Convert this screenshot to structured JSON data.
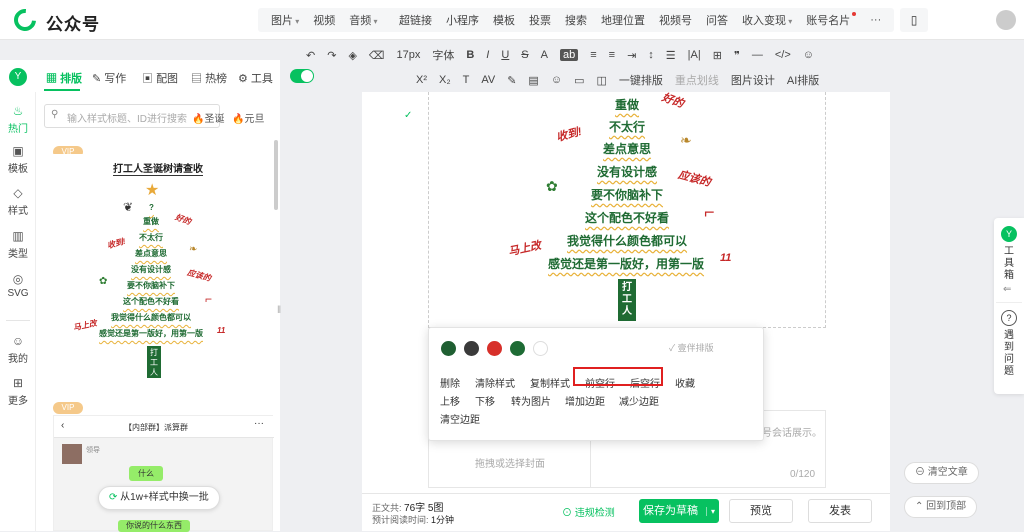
{
  "app": {
    "name": "公众号"
  },
  "topnav": {
    "group1": [
      "图片",
      "视频",
      "音频"
    ],
    "group2": [
      "超链接",
      "小程序",
      "模板",
      "投票",
      "搜索",
      "地理位置",
      "视频号",
      "问答",
      "收入变现",
      "账号名片"
    ],
    "more": "···"
  },
  "toolbar2": {
    "font_size": "17px",
    "font_label": "字体",
    "bold": "B",
    "italic": "I",
    "underline": "U",
    "strike": "S",
    "quote": "❞"
  },
  "toolbar3": {
    "auto_layout": "一键排版",
    "highlight": "重点划线",
    "image_design": "图片设计",
    "ai_layout": "AI排版"
  },
  "panel": {
    "tabs": [
      "排版",
      "写作",
      "配图",
      "热榜",
      "工具"
    ],
    "search_placeholder": "输入样式标题、ID进行搜索",
    "tags": [
      "圣诞",
      "元旦"
    ],
    "vip": "VIP",
    "card1": {
      "title": "打工人圣诞树请查收",
      "q": "?",
      "lines": [
        "重做",
        "不太行",
        "差点意思",
        "没有设计感",
        "要不你脑补下",
        "这个配色不好看",
        "我觉得什么颜色都可以",
        "感觉还是第一版好，用第一版"
      ],
      "side": [
        "好的",
        "收到!",
        "应该的",
        "马上改",
        "11"
      ],
      "box": "打工人"
    },
    "card2": {
      "title": "【内部群】派算群",
      "user": "领导",
      "msgs": [
        "什么",
        "你说的什么东西"
      ],
      "swap": "从1w+样式中换一批"
    }
  },
  "leftrail": [
    "热门",
    "模板",
    "样式",
    "类型",
    "SVG",
    "我的",
    "更多"
  ],
  "editor": {
    "lines": [
      "重做",
      "不太行",
      "差点意思",
      "没有设计感",
      "要不你脑补下",
      "这个配色不好看",
      "我觉得什么颜色都可以",
      "感觉还是第一版好，用第一版"
    ],
    "side": [
      "好的",
      "收到!",
      "应该的",
      "马上改",
      "11"
    ],
    "box": "打工人",
    "cover_text": "拖拽或选择封面",
    "summary_hint": "号会话展示。",
    "counter": "0/120"
  },
  "popup": {
    "colors": [
      "#1f5f32",
      "#3a3a3a",
      "#d7302a",
      "#1e6b34",
      "#ffffff"
    ],
    "companion": "壹伴排版",
    "row1": [
      "删除",
      "清除样式",
      "复制样式",
      "前空行",
      "后空行",
      "收藏"
    ],
    "row2": [
      "上移",
      "下移",
      "转为图片",
      "增加边距",
      "减少边距"
    ],
    "row3": [
      "清空边距"
    ]
  },
  "status": {
    "word_label": "正文共:",
    "word_value": "76字 5图",
    "read_label": "预计阅读时间:",
    "read_value": "1分钟"
  },
  "buttons": {
    "check": "违规检测",
    "save": "保存为草稿",
    "preview": "预览",
    "publish": "发表"
  },
  "rightrail": {
    "toolbox": "工具箱",
    "problem": "遇到问题"
  },
  "floating": {
    "clear": "清空文章",
    "top": "回到顶部"
  }
}
